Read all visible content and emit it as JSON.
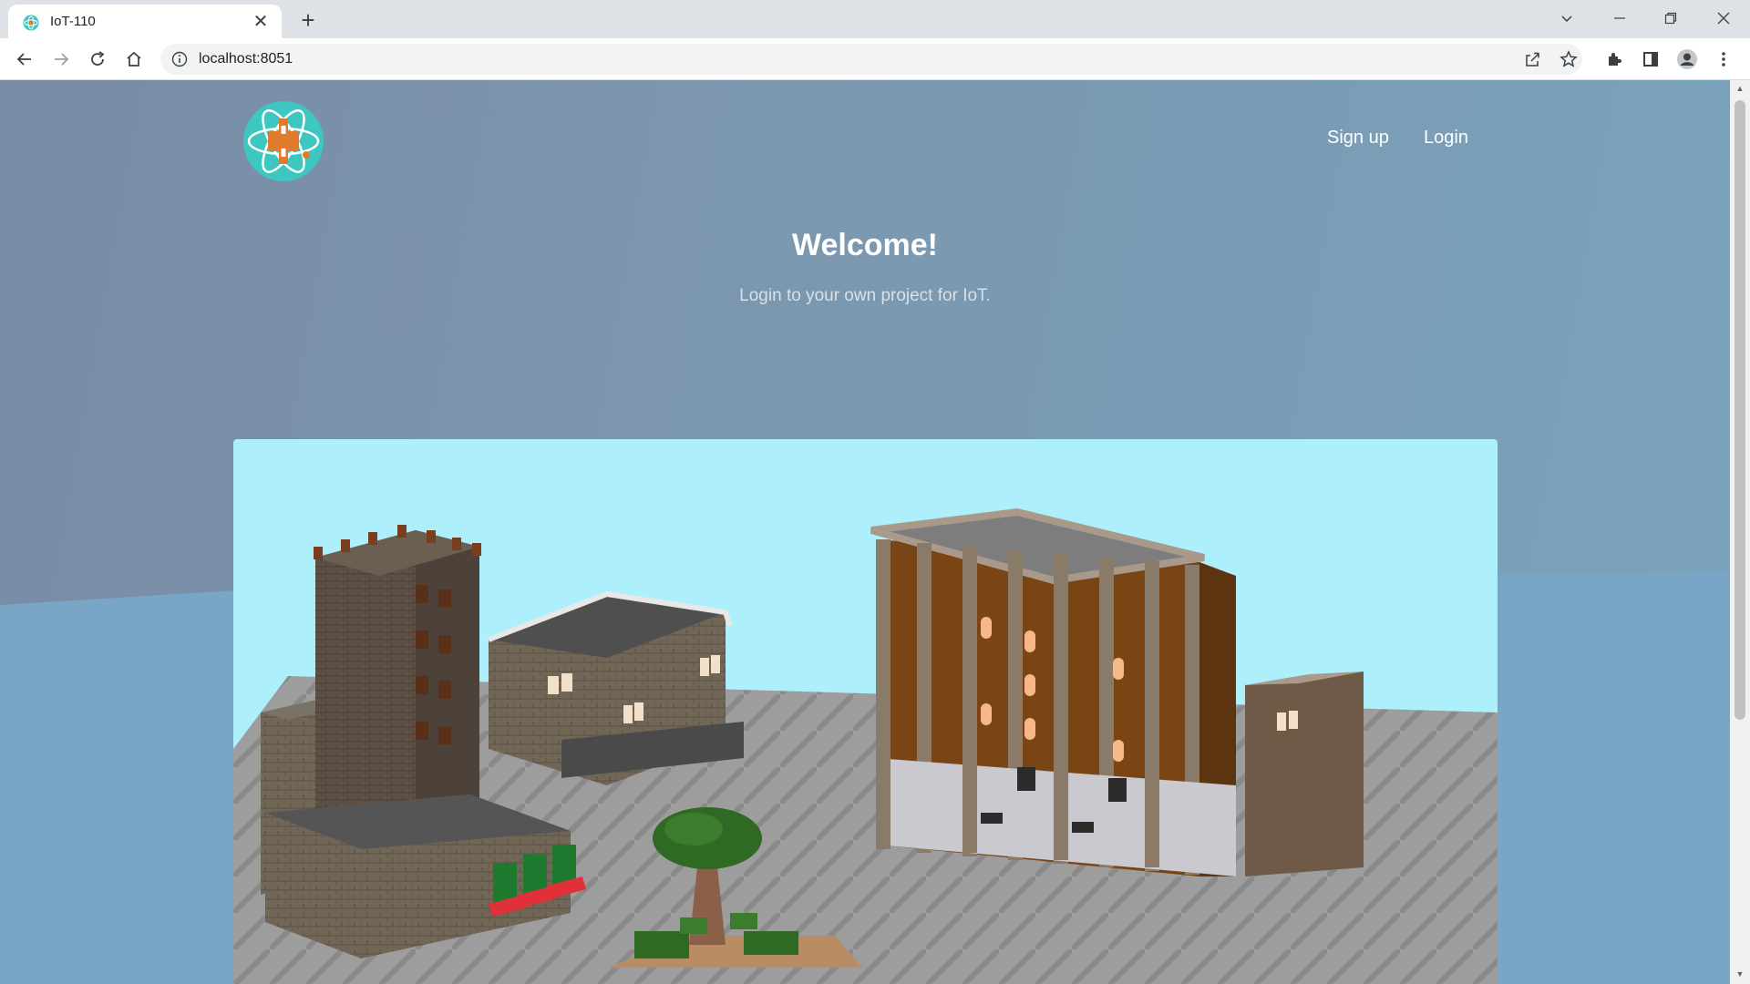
{
  "browser": {
    "tab_title": "IoT-110",
    "tab_close": "✕",
    "new_tab": "+",
    "url": "localhost:8051",
    "icons": [
      "favicon-icon",
      "back-arrow-icon",
      "forward-arrow-icon",
      "reload-icon",
      "home-icon",
      "info-icon",
      "share-icon",
      "star-icon",
      "extensions-icon",
      "side-panel-icon",
      "profile-icon",
      "menu-icon",
      "chevron-down-icon",
      "minimize-icon",
      "restore-icon",
      "close-icon"
    ]
  },
  "header": {
    "signup_label": "Sign up",
    "login_label": "Login"
  },
  "hero": {
    "title": "Welcome!",
    "subtitle": "Login to your own project for IoT."
  },
  "colors": {
    "page_bg": "#7b97ae",
    "sky": "#adeffb",
    "brick": "#6b4a2c",
    "stone": "#5a5249",
    "logo_teal": "#3ec6c0",
    "logo_orange": "#e07a2c"
  }
}
